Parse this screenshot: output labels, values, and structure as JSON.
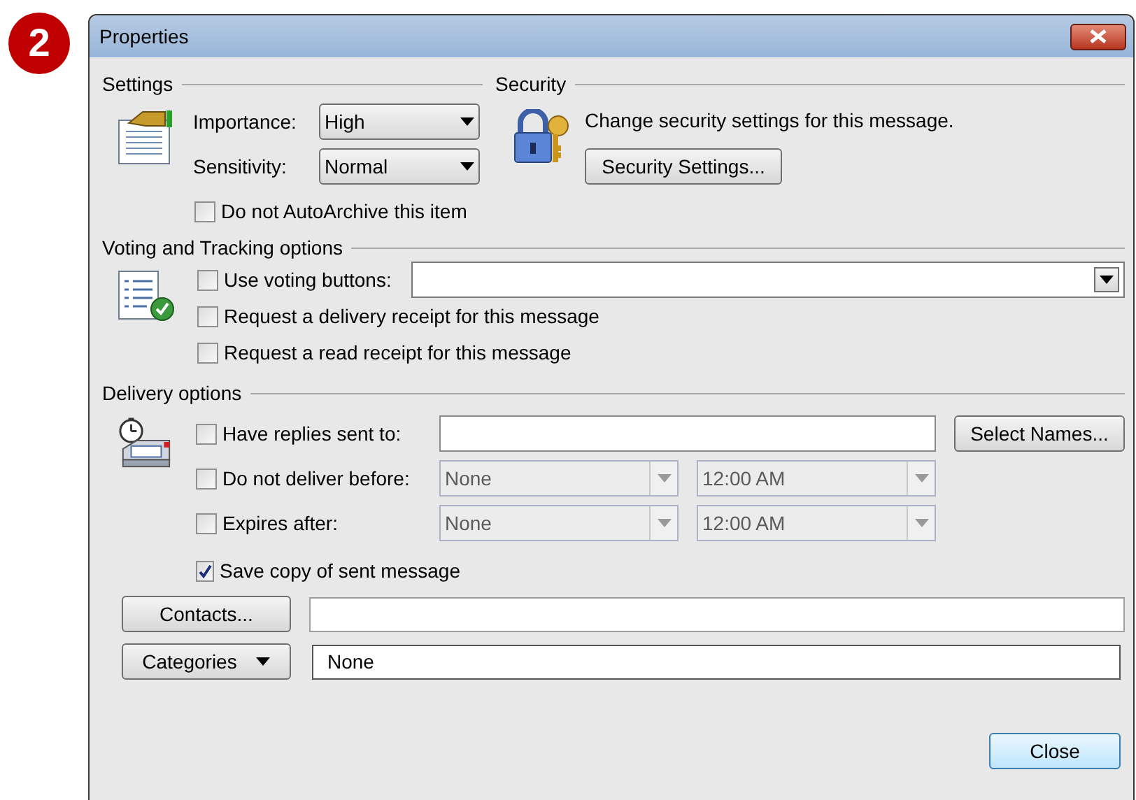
{
  "badge": "2",
  "window": {
    "title": "Properties"
  },
  "settings": {
    "heading": "Settings",
    "fields": [
      {
        "label": "Importance:",
        "value": "High"
      },
      {
        "label": "Sensitivity:",
        "value": "Normal"
      }
    ],
    "autoarchive": {
      "label": "Do not AutoArchive this item",
      "checked": false
    }
  },
  "security": {
    "heading": "Security",
    "text": "Change security settings for this message.",
    "button": "Security Settings..."
  },
  "voting": {
    "heading": "Voting and Tracking options",
    "options": [
      {
        "kind": "combo",
        "label": "Use voting buttons:",
        "checked": false
      },
      {
        "kind": "plain",
        "label": "Request a delivery receipt for this message",
        "checked": false
      },
      {
        "kind": "plain",
        "label": "Request a read receipt for this message",
        "checked": false
      }
    ]
  },
  "delivery": {
    "heading": "Delivery options",
    "rows": [
      {
        "kind": "text",
        "label": "Have replies sent to:",
        "checked": false,
        "button": "Select Names..."
      },
      {
        "kind": "datetime",
        "label": "Do not deliver before:",
        "checked": false,
        "date": "None",
        "time": "12:00 AM",
        "disabled": true
      },
      {
        "kind": "datetime",
        "label": "Expires after:",
        "checked": false,
        "date": "None",
        "time": "12:00 AM",
        "disabled": true
      },
      {
        "kind": "plain",
        "label": "Save copy of sent message",
        "checked": true
      }
    ]
  },
  "contacts": {
    "button": "Contacts..."
  },
  "categories": {
    "button": "Categories",
    "value": "None"
  },
  "buttons": [
    "Close"
  ]
}
